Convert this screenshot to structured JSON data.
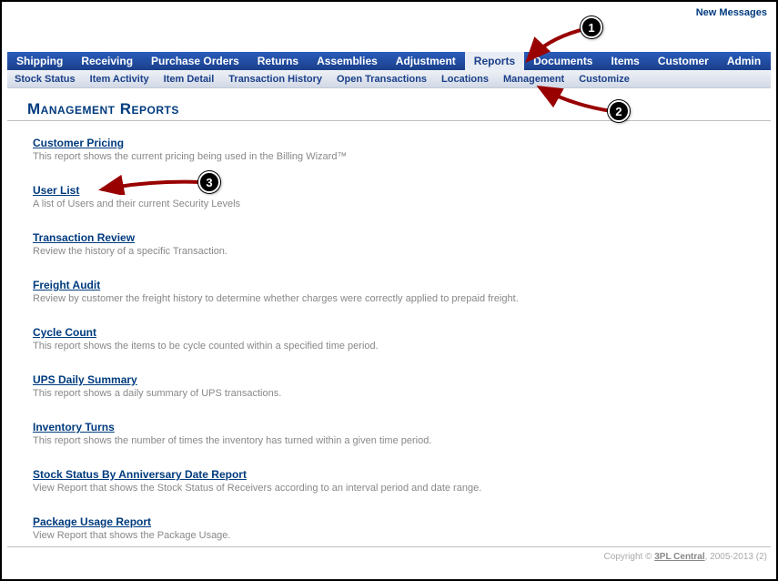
{
  "top_right": {
    "new_messages": "New Messages"
  },
  "main_nav": {
    "items": [
      {
        "label": "Shipping"
      },
      {
        "label": "Receiving"
      },
      {
        "label": "Purchase Orders"
      },
      {
        "label": "Returns"
      },
      {
        "label": "Assemblies"
      },
      {
        "label": "Adjustment"
      },
      {
        "label": "Reports",
        "active": true
      },
      {
        "label": "Documents"
      },
      {
        "label": "Items"
      },
      {
        "label": "Customer"
      },
      {
        "label": "Admin"
      }
    ]
  },
  "sub_nav": {
    "items": [
      {
        "label": "Stock Status"
      },
      {
        "label": "Item Activity"
      },
      {
        "label": "Item Detail"
      },
      {
        "label": "Transaction History"
      },
      {
        "label": "Open Transactions"
      },
      {
        "label": "Locations"
      },
      {
        "label": "Management"
      },
      {
        "label": "Customize"
      }
    ]
  },
  "page": {
    "title": "Management Reports"
  },
  "reports": [
    {
      "name": "Customer Pricing",
      "desc": "This report shows the current pricing being used in the Billing Wizard™"
    },
    {
      "name": "User List",
      "desc": "A list of Users and their current Security Levels"
    },
    {
      "name": "Transaction Review",
      "desc": "Review the history of a specific Transaction."
    },
    {
      "name": "Freight Audit",
      "desc": "Review by customer the freight history to determine whether charges were correctly applied to prepaid freight."
    },
    {
      "name": "Cycle Count",
      "desc": "This report shows the items to be cycle counted within a specified time period."
    },
    {
      "name": "UPS Daily Summary",
      "desc": "This report shows a daily summary of UPS transactions."
    },
    {
      "name": "Inventory Turns",
      "desc": "This report shows the number of times the inventory has turned within a given time period."
    },
    {
      "name": "Stock Status By Anniversary Date Report",
      "desc": "View Report that shows the Stock Status of Receivers according to an interval period and date range."
    },
    {
      "name": "Package Usage Report",
      "desc": "View Report that shows the Package Usage."
    }
  ],
  "footer": {
    "pre": "Copyright © ",
    "link": "3PL Central",
    "post": ", 2005-2013 (2)"
  },
  "callouts": {
    "c1": "1",
    "c2": "2",
    "c3": "3"
  }
}
